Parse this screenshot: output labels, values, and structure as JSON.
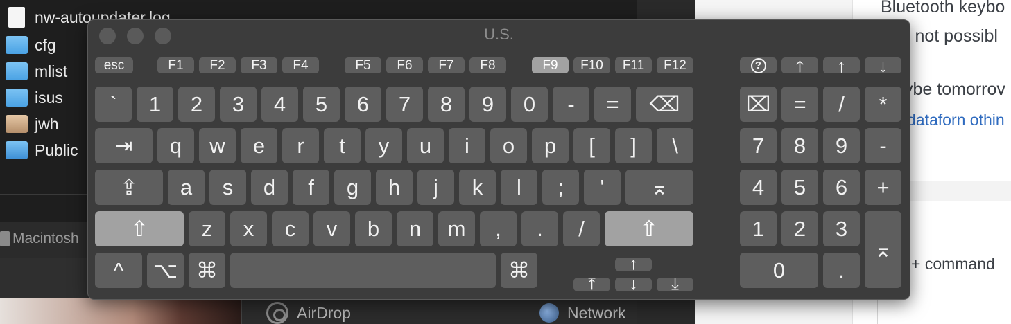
{
  "finder": {
    "files": [
      {
        "name": "nw-autoupdater.log",
        "icon": "document-icon"
      },
      {
        "name": "cfg",
        "icon": "folder-icon"
      },
      {
        "name": "mlist",
        "icon": "folder-icon"
      },
      {
        "name": "isus",
        "icon": "folder-icon"
      },
      {
        "name": "jwh",
        "icon": "home-folder-icon"
      },
      {
        "name": "Public",
        "icon": "public-folder-icon"
      }
    ],
    "device": "Macintosh",
    "airdrop": "AirDrop",
    "network": "Network"
  },
  "webpage": {
    "lines": [
      "Bluetooth keybo",
      "s not possibl",
      "ybe tomorrov",
      "dataforn othin",
      "+ command"
    ]
  },
  "keyboard": {
    "title": "U.S.",
    "fn_row": [
      "esc",
      "F1",
      "F2",
      "F3",
      "F4",
      "F5",
      "F6",
      "F7",
      "F8",
      "F9",
      "F10",
      "F11",
      "F12",
      "?⃝",
      "⤒",
      "↑",
      "↓"
    ],
    "number_row": [
      "`",
      "1",
      "2",
      "3",
      "4",
      "5",
      "6",
      "7",
      "8",
      "9",
      "0",
      "-",
      "=",
      "⌫"
    ],
    "q_row": [
      "⇥",
      "q",
      "w",
      "e",
      "r",
      "t",
      "y",
      "u",
      "i",
      "o",
      "p",
      "[",
      "]",
      "\\"
    ],
    "a_row": [
      "⇪",
      "a",
      "s",
      "d",
      "f",
      "g",
      "h",
      "j",
      "k",
      "l",
      ";",
      "'",
      "⌅"
    ],
    "z_row": [
      "⇧",
      "z",
      "x",
      "c",
      "v",
      "b",
      "n",
      "m",
      ",",
      ".",
      "/",
      "⇧"
    ],
    "bottom_row": [
      "^",
      "⌥",
      "⌘",
      "",
      "⌘"
    ],
    "arrows": {
      "up": "↑",
      "home": "⤒",
      "down": "↓",
      "end": "⤓"
    },
    "numpad": {
      "row1": [
        "⌧",
        "=",
        "/",
        "*"
      ],
      "row2": [
        "7",
        "8",
        "9",
        "-"
      ],
      "row3": [
        "4",
        "5",
        "6",
        "+"
      ],
      "row4": [
        "1",
        "2",
        "3"
      ],
      "row5": [
        "0",
        "."
      ],
      "enter": "⌅"
    }
  },
  "colors": {
    "key": "#5e5e5e",
    "key_highlight": "#a2a2a2",
    "window": "#3c3c3c"
  }
}
